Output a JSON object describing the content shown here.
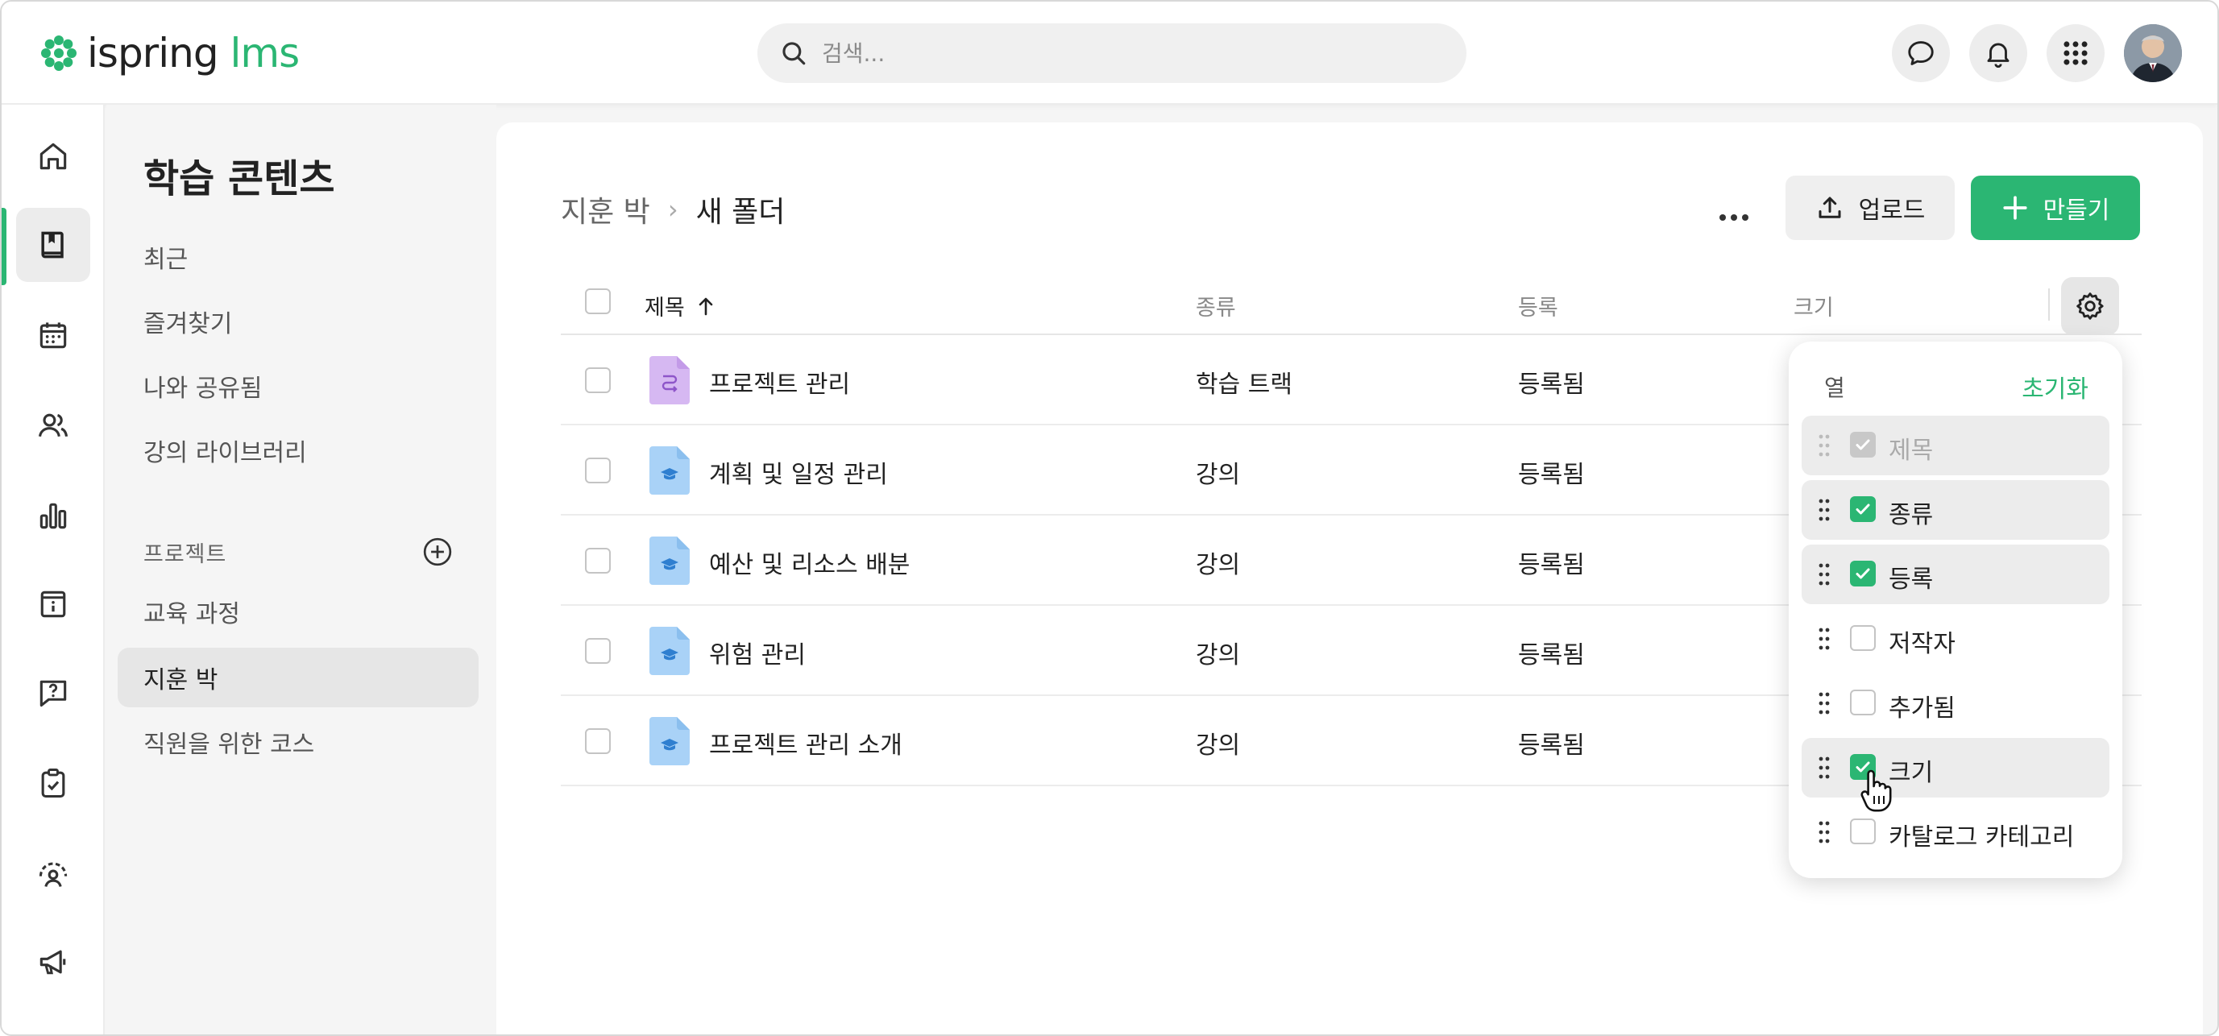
{
  "app": {
    "logo_text": "ispring",
    "logo_suffix": "lms",
    "brand_color": "#2bb673"
  },
  "header": {
    "search_placeholder": "검색..."
  },
  "rail": {
    "items": [
      {
        "icon": "home-icon"
      },
      {
        "icon": "book-icon",
        "active": true
      },
      {
        "icon": "calendar-icon"
      },
      {
        "icon": "users-icon"
      },
      {
        "icon": "bar-chart-icon"
      },
      {
        "icon": "info-icon"
      },
      {
        "icon": "question-icon"
      },
      {
        "icon": "clipboard-check-icon"
      },
      {
        "icon": "gauge-user-icon"
      },
      {
        "icon": "megaphone-icon"
      }
    ]
  },
  "subnav": {
    "title": "학습 콘텐츠",
    "items": [
      "최근",
      "즐겨찾기",
      "나와 공유됨",
      "강의 라이브러리"
    ],
    "section_label": "프로젝트",
    "projects": [
      "교육 과정",
      "지훈 박",
      "직원을 위한 코스"
    ]
  },
  "breadcrumb": {
    "root": "지훈 박",
    "separator": "›",
    "current": "새 폴더"
  },
  "toolbar": {
    "upload_label": "업로드",
    "create_label": "만들기"
  },
  "table": {
    "columns": {
      "title": "제목",
      "type": "종류",
      "status": "등록",
      "size": "크기"
    },
    "rows": [
      {
        "title": "프로젝트 관리",
        "type": "학습 트랙",
        "status": "등록됨",
        "icon": "learning-track-icon"
      },
      {
        "title": "계획 및 일정 관리",
        "type": "강의",
        "status": "등록됨",
        "icon": "course-icon"
      },
      {
        "title": "예산 및 리소스 배분",
        "type": "강의",
        "status": "등록됨",
        "icon": "course-icon"
      },
      {
        "title": "위험 관리",
        "type": "강의",
        "status": "등록됨",
        "icon": "course-icon"
      },
      {
        "title": "프로젝트 관리 소개",
        "type": "강의",
        "status": "등록됨",
        "icon": "course-icon"
      }
    ]
  },
  "columns_popover": {
    "header": "열",
    "reset": "초기화",
    "items": [
      {
        "label": "제목",
        "checked": true,
        "disabled": true
      },
      {
        "label": "종류",
        "checked": true
      },
      {
        "label": "등록",
        "checked": true
      },
      {
        "label": "저작자",
        "checked": false
      },
      {
        "label": "추가됨",
        "checked": false
      },
      {
        "label": "크기",
        "checked": true
      },
      {
        "label": "카탈로그 카테고리",
        "checked": false
      }
    ]
  }
}
